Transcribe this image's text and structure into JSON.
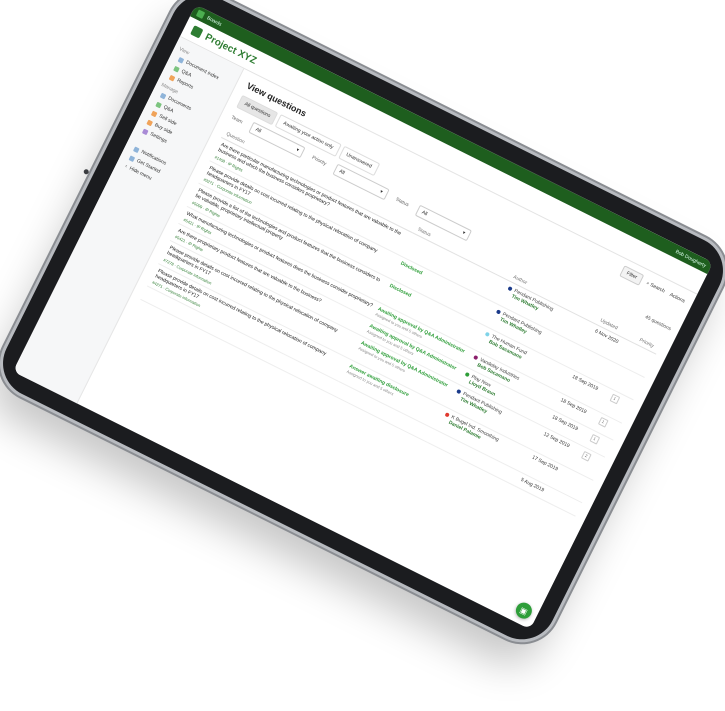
{
  "topbar": {
    "product": "Boards",
    "user": "Bob Dougherty"
  },
  "project_title": "Project XYZ",
  "sidebar": {
    "view_heading": "View",
    "view_items": [
      {
        "label": "Document index",
        "icon": "document-icon"
      },
      {
        "label": "Q&A",
        "icon": "qa-icon"
      },
      {
        "label": "Reports",
        "icon": "reports-icon"
      }
    ],
    "manage_heading": "Manage",
    "manage_items": [
      {
        "label": "Documents",
        "icon": "documents-icon"
      },
      {
        "label": "Q&A",
        "icon": "qa-icon"
      },
      {
        "label": "Sell side",
        "icon": "sell-side-icon"
      },
      {
        "label": "Buy side",
        "icon": "buy-side-icon"
      },
      {
        "label": "Settings",
        "icon": "settings-icon"
      }
    ],
    "bottom_items": [
      {
        "label": "Notifications",
        "icon": "bell-icon"
      },
      {
        "label": "Get Started",
        "icon": "rocket-icon"
      },
      {
        "label": "Hide menu",
        "icon": "chevron-left-icon"
      }
    ]
  },
  "main": {
    "title": "View questions",
    "tabs": [
      "All questions",
      "Awaiting your action only",
      "Unanswered"
    ],
    "filters": {
      "team_label": "Team",
      "team_value": "All",
      "priority_label": "Priority",
      "priority_value": "All",
      "status_label": "Status",
      "status_value": "All"
    },
    "toolbar": {
      "filter": "Filter",
      "search": "Search",
      "actions": "Actions"
    },
    "count": "45 questions",
    "columns": {
      "question": "Question",
      "status": "Status",
      "author": "Author",
      "updated": "Updated",
      "priority": "Priority"
    }
  },
  "rows": [
    {
      "question": "Are there particular manufacturing technologies or product features that are valuable to the business and which the business considers proprietary?",
      "meta": "#1458 · IP Rights",
      "status": "",
      "status_sub": "",
      "org": "Pendant Publishing",
      "name": "Tim Whatley",
      "role": "",
      "date": "6 Nov 2020",
      "dot": "#1a3a8a",
      "prio": ""
    },
    {
      "question": "Please provide details on cost incurred relating to the physical relocation of company headquarters in FY17",
      "meta": "#3271 · Corporate information",
      "status": "Disclosed",
      "status_sub": "",
      "org": "Pendant Publishing",
      "name": "Tim Whatley",
      "role": "",
      "date": "",
      "dot": "#1a3a8a",
      "prio": ""
    },
    {
      "question": "Please provide a list of the technologies and product features that the business considers to be valuable, proprietary intellectual property",
      "meta": "#5009 · IP Rights",
      "status": "Disclosed",
      "status_sub": "",
      "org": "The Human Fund",
      "name": "Bob Sacamano",
      "role": "",
      "date": "18 Sep 2019",
      "dot": "#7fd3e8",
      "prio": "1"
    },
    {
      "question": "What manufacturing technologies or product features does the business consider proprietary?",
      "meta": "#5421 · IP Rights",
      "status": "Awaiting approval by Q&A Administrator",
      "status_sub": "Assigned to you and 5 others",
      "org": "Vandelay Industries",
      "name": "Bob Sacamano",
      "role": "",
      "date": "18 Sep 2019",
      "dot": "#8b1f6b",
      "prio": "1"
    },
    {
      "question": "Are there proprietary product features that are valuable to the business?",
      "meta": "#5421 · IP Rights",
      "status": "Awaiting approval by Q&A Administrator",
      "status_sub": "Assigned to you and 5 others",
      "org": "Play Now",
      "name": "Lloyd Braun",
      "role": "",
      "date": "18 Sep 2019",
      "dot": "#2e9e39",
      "prio": "1"
    },
    {
      "question": "Please provide details on cost incurred relating to the physical relocation of company headquarters in FY17",
      "meta": "#7278 · Corporate information",
      "status": "Awaiting approval by Q&A Administrator",
      "status_sub": "Assigned to you and 5 others",
      "org": "Pendant Publishing",
      "name": "Tim Whatley",
      "role": "",
      "date": "12 Sep 2019",
      "dot": "#1a3a8a",
      "prio": "2"
    },
    {
      "question": "Please provide details on cost incurred relating to the physical relocation of company headquarters in FY17",
      "meta": "#4271 · Corporate information",
      "status": "Answer awaiting disclosure",
      "status_sub": "Assigned to you and 5 others",
      "org": "K Bugel Ind. Smoothing",
      "name": "Daniel Palamie",
      "role": "",
      "date": "17 Sep 2019",
      "dot": "#e03a2f",
      "prio": ""
    },
    {
      "question": "",
      "meta": "",
      "status": "",
      "status_sub": "",
      "org": "",
      "name": "",
      "role": "",
      "date": "5 Aug 2019",
      "dot": "",
      "prio": ""
    }
  ]
}
